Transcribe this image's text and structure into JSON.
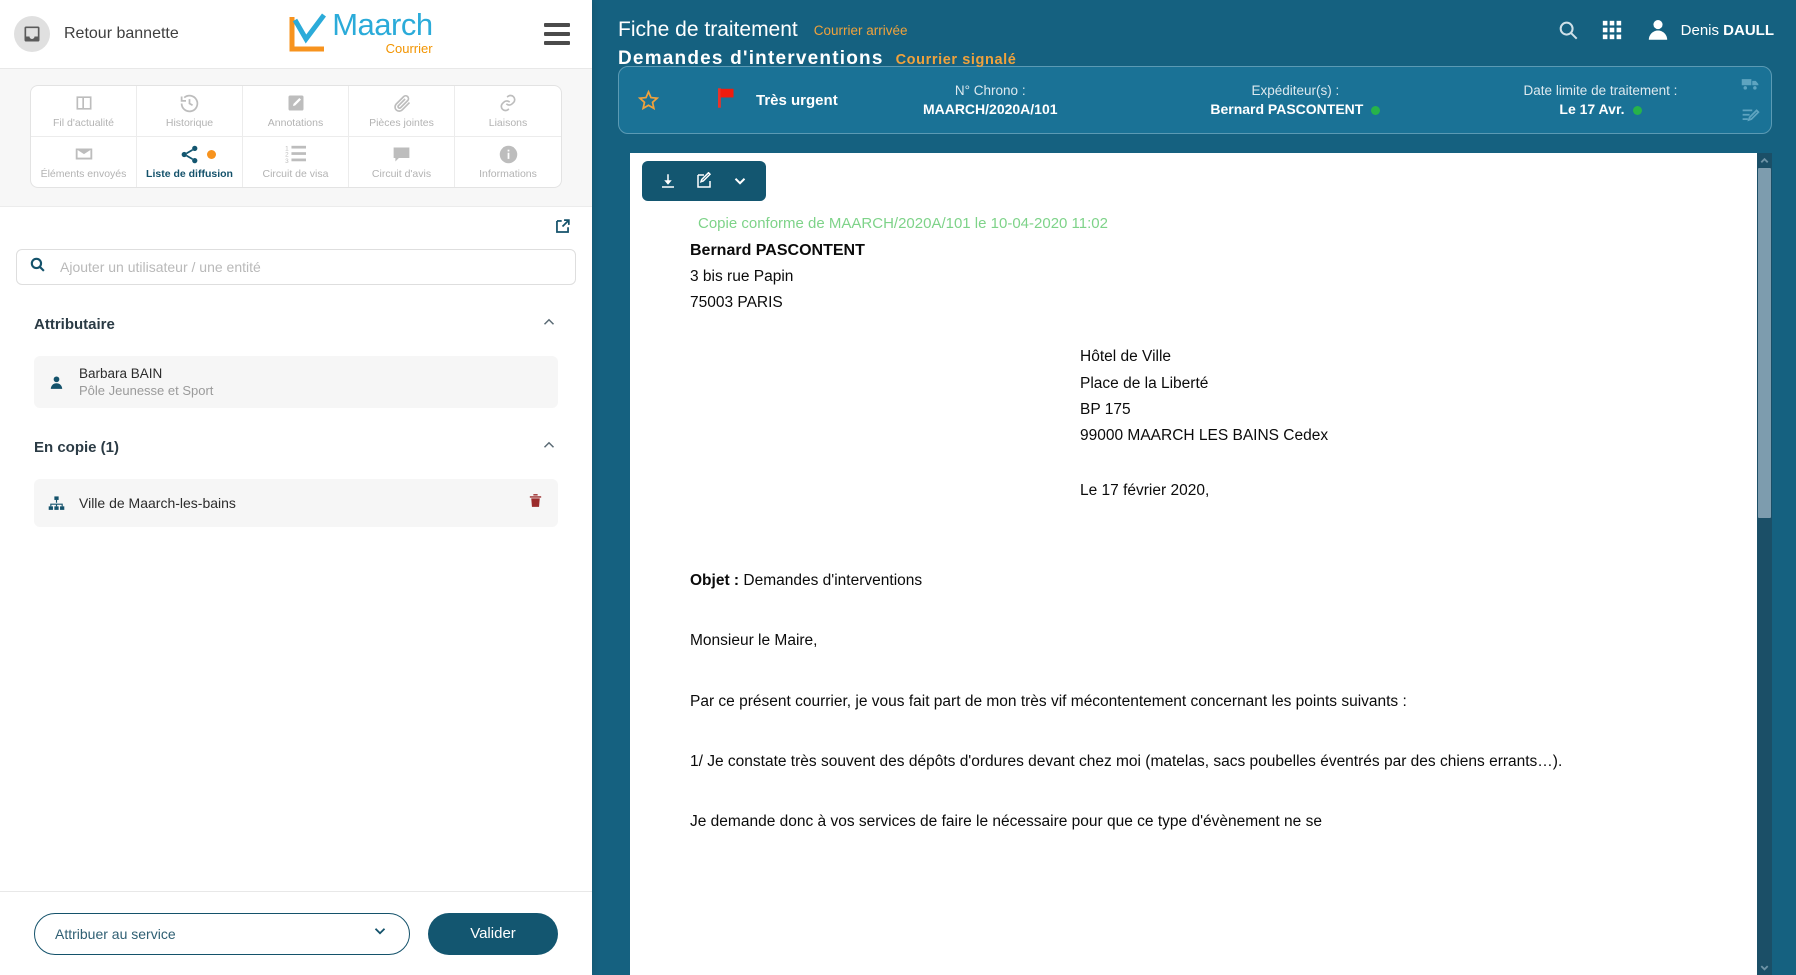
{
  "sidebar": {
    "back_label": "Retour bannette",
    "logo": {
      "brand": "Maarch",
      "sub": "Courrier"
    },
    "tabs": [
      {
        "label": "Fil d'actualité",
        "icon": "columns-icon",
        "active": false,
        "badge": false
      },
      {
        "label": "Historique",
        "icon": "history-icon",
        "active": false,
        "badge": false
      },
      {
        "label": "Annotations",
        "icon": "pencil-square-icon",
        "active": false,
        "badge": false
      },
      {
        "label": "Pièces jointes",
        "icon": "paperclip-icon",
        "active": false,
        "badge": false
      },
      {
        "label": "Liaisons",
        "icon": "link-icon",
        "active": false,
        "badge": false
      },
      {
        "label": "Éléments envoyés",
        "icon": "envelope-icon",
        "active": false,
        "badge": false
      },
      {
        "label": "Liste de diffusion",
        "icon": "share-icon",
        "active": true,
        "badge": true
      },
      {
        "label": "Circuit de visa",
        "icon": "ordered-list-icon",
        "active": false,
        "badge": false
      },
      {
        "label": "Circuit d'avis",
        "icon": "comment-icon",
        "active": false,
        "badge": false
      },
      {
        "label": "Informations",
        "icon": "info-icon",
        "active": false,
        "badge": false
      }
    ],
    "search": {
      "placeholder": "Ajouter un utilisateur / une entité",
      "value": ""
    },
    "groups": [
      {
        "title": "Attributaire",
        "entries": [
          {
            "name": "Barbara BAIN",
            "sub": "Pôle Jeunesse et Sport",
            "icon": "user-icon",
            "deletable": false
          }
        ]
      },
      {
        "title": "En copie (1)",
        "entries": [
          {
            "name": "Ville de Maarch-les-bains",
            "sub": "",
            "icon": "sitemap-icon",
            "deletable": true
          }
        ]
      }
    ],
    "footer": {
      "select_label": "Attribuer au service",
      "validate_label": "Valider"
    }
  },
  "header": {
    "title": "Fiche de traitement",
    "subtitle": "Courrier arrivée",
    "user_first": "Denis",
    "user_last": "DAULL",
    "icons": {
      "search": "search-icon",
      "apps": "grid-apps-icon",
      "avatar": "user-avatar-icon"
    }
  },
  "doc_header": {
    "title": "Demandes d'interventions",
    "flag": "Courrier signalé",
    "priority_label": "Très urgent",
    "fields": [
      {
        "label": "N° Chrono :",
        "value": "MAARCH/2020A/101",
        "dot": false
      },
      {
        "label": "Expéditeur(s) :",
        "value": "Bernard PASCONTENT",
        "dot": true
      },
      {
        "label": "Date limite de traitement :",
        "value": "Le 17 Avr.",
        "dot": true
      }
    ],
    "dot_color": "#27b34a",
    "accent_color": "#f0a23c"
  },
  "doc_toolbar": {
    "buttons": [
      {
        "name": "download-icon",
        "glyph": "⤓"
      },
      {
        "name": "edit-icon",
        "glyph": "✎"
      },
      {
        "name": "chevron-down-icon",
        "glyph": "⌄"
      }
    ]
  },
  "document": {
    "stamp": "Copie conforme de MAARCH/2020A/101 le 10-04-2020 11:02",
    "sender_name": "Bernard PASCONTENT",
    "sender_addr1": "3 bis rue Papin",
    "sender_addr2": "75003 PARIS",
    "dest_line1": "Hôtel de Ville",
    "dest_line2": "Place de la Liberté",
    "dest_line3": "BP 175",
    "dest_line4": "99000 MAARCH LES BAINS Cedex",
    "date_line": "Le 17 février 2020,",
    "objet_label": "Objet :",
    "objet_value": " Demandes d'interventions",
    "salutation": "Monsieur le Maire,",
    "para1": "Par ce présent courrier, je vous fait part de mon très vif mécontentement concernant les points suivants :",
    "para2": "1/ Je constate très souvent des dépôts d'ordures devant chez moi (matelas, sacs poubelles éventrés par des chiens errants…).",
    "para3": "Je demande donc à vos services de faire le nécessaire pour que ce type d'évènement ne se"
  }
}
